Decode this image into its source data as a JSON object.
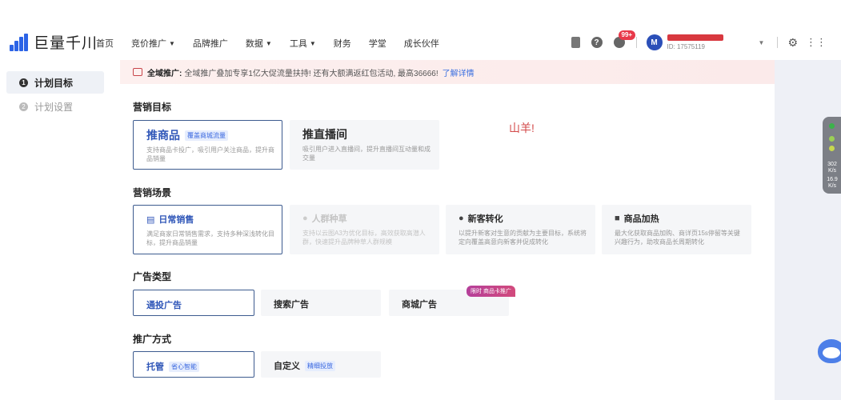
{
  "app": {
    "logo_text": "巨量千川"
  },
  "nav": [
    {
      "label": "首页",
      "caret": false
    },
    {
      "label": "竞价推广",
      "caret": true
    },
    {
      "label": "品牌推广",
      "caret": false
    },
    {
      "label": "数据",
      "caret": true
    },
    {
      "label": "工具",
      "caret": true
    },
    {
      "label": "财务",
      "caret": false
    },
    {
      "label": "学堂",
      "caret": false
    },
    {
      "label": "成长伙伴",
      "caret": false
    }
  ],
  "header": {
    "notification_badge": "99+",
    "avatar_letter": "M",
    "user_id": "ID: 17575119"
  },
  "sidebar": {
    "items": [
      {
        "step": "1",
        "label": "计划目标"
      },
      {
        "step": "2",
        "label": "计划设置"
      }
    ]
  },
  "promo": {
    "label": "全域推广:",
    "text": "全域推广叠加专享1亿大促流量扶持! 还有大额满返红包活动, 最高36666!",
    "link": "了解详情"
  },
  "marketing_goal": {
    "title": "营销目标",
    "options": [
      {
        "title": "推商品",
        "tag": "覆盖商城流量",
        "desc": "支持商品卡投广，吸引用户关注商品，提升商品销量"
      },
      {
        "title": "推直播间",
        "desc": "吸引用户进入直播间，提升直播间互动量和成交量"
      }
    ]
  },
  "marketing_scene": {
    "title": "营销场景",
    "options": [
      {
        "icon": "📖",
        "title": "日常销售",
        "desc": "满足商家日常销售需求，支持多种深浅转化目标，提升商品销量"
      },
      {
        "icon": "👤",
        "title": "人群种草",
        "desc": "支持以云图A3为优化目标，高效获取高潜人群，快速提升品牌种草人群规模"
      },
      {
        "icon": "👤",
        "title": "新客转化",
        "desc": "以提升新客对生意的贡献为主要目标，系统将定向覆盖高意向新客并促成转化"
      },
      {
        "icon": "🏠",
        "title": "商品加热",
        "desc": "最大化获取商品加购、商详页15s停留等关键兴趣行为，助攻商品长周期转化"
      }
    ]
  },
  "ad_type": {
    "title": "广告类型",
    "options": [
      {
        "label": "通投广告"
      },
      {
        "label": "搜索广告"
      },
      {
        "label": "商城广告",
        "corner_tag": "限时 商品卡推广"
      }
    ]
  },
  "promo_method": {
    "title": "推广方式",
    "options": [
      {
        "label": "托管",
        "tag": "省心智能"
      },
      {
        "label": "自定义",
        "tag": "精细投放"
      }
    ]
  },
  "watermark": "山羊!",
  "speed_meter": {
    "up": "302",
    "down": "16.9",
    "unit": "K/s"
  },
  "colors": {
    "accent": "#2f56b8",
    "selected_border": "#3d5b8f",
    "badge": "#e8394a"
  }
}
